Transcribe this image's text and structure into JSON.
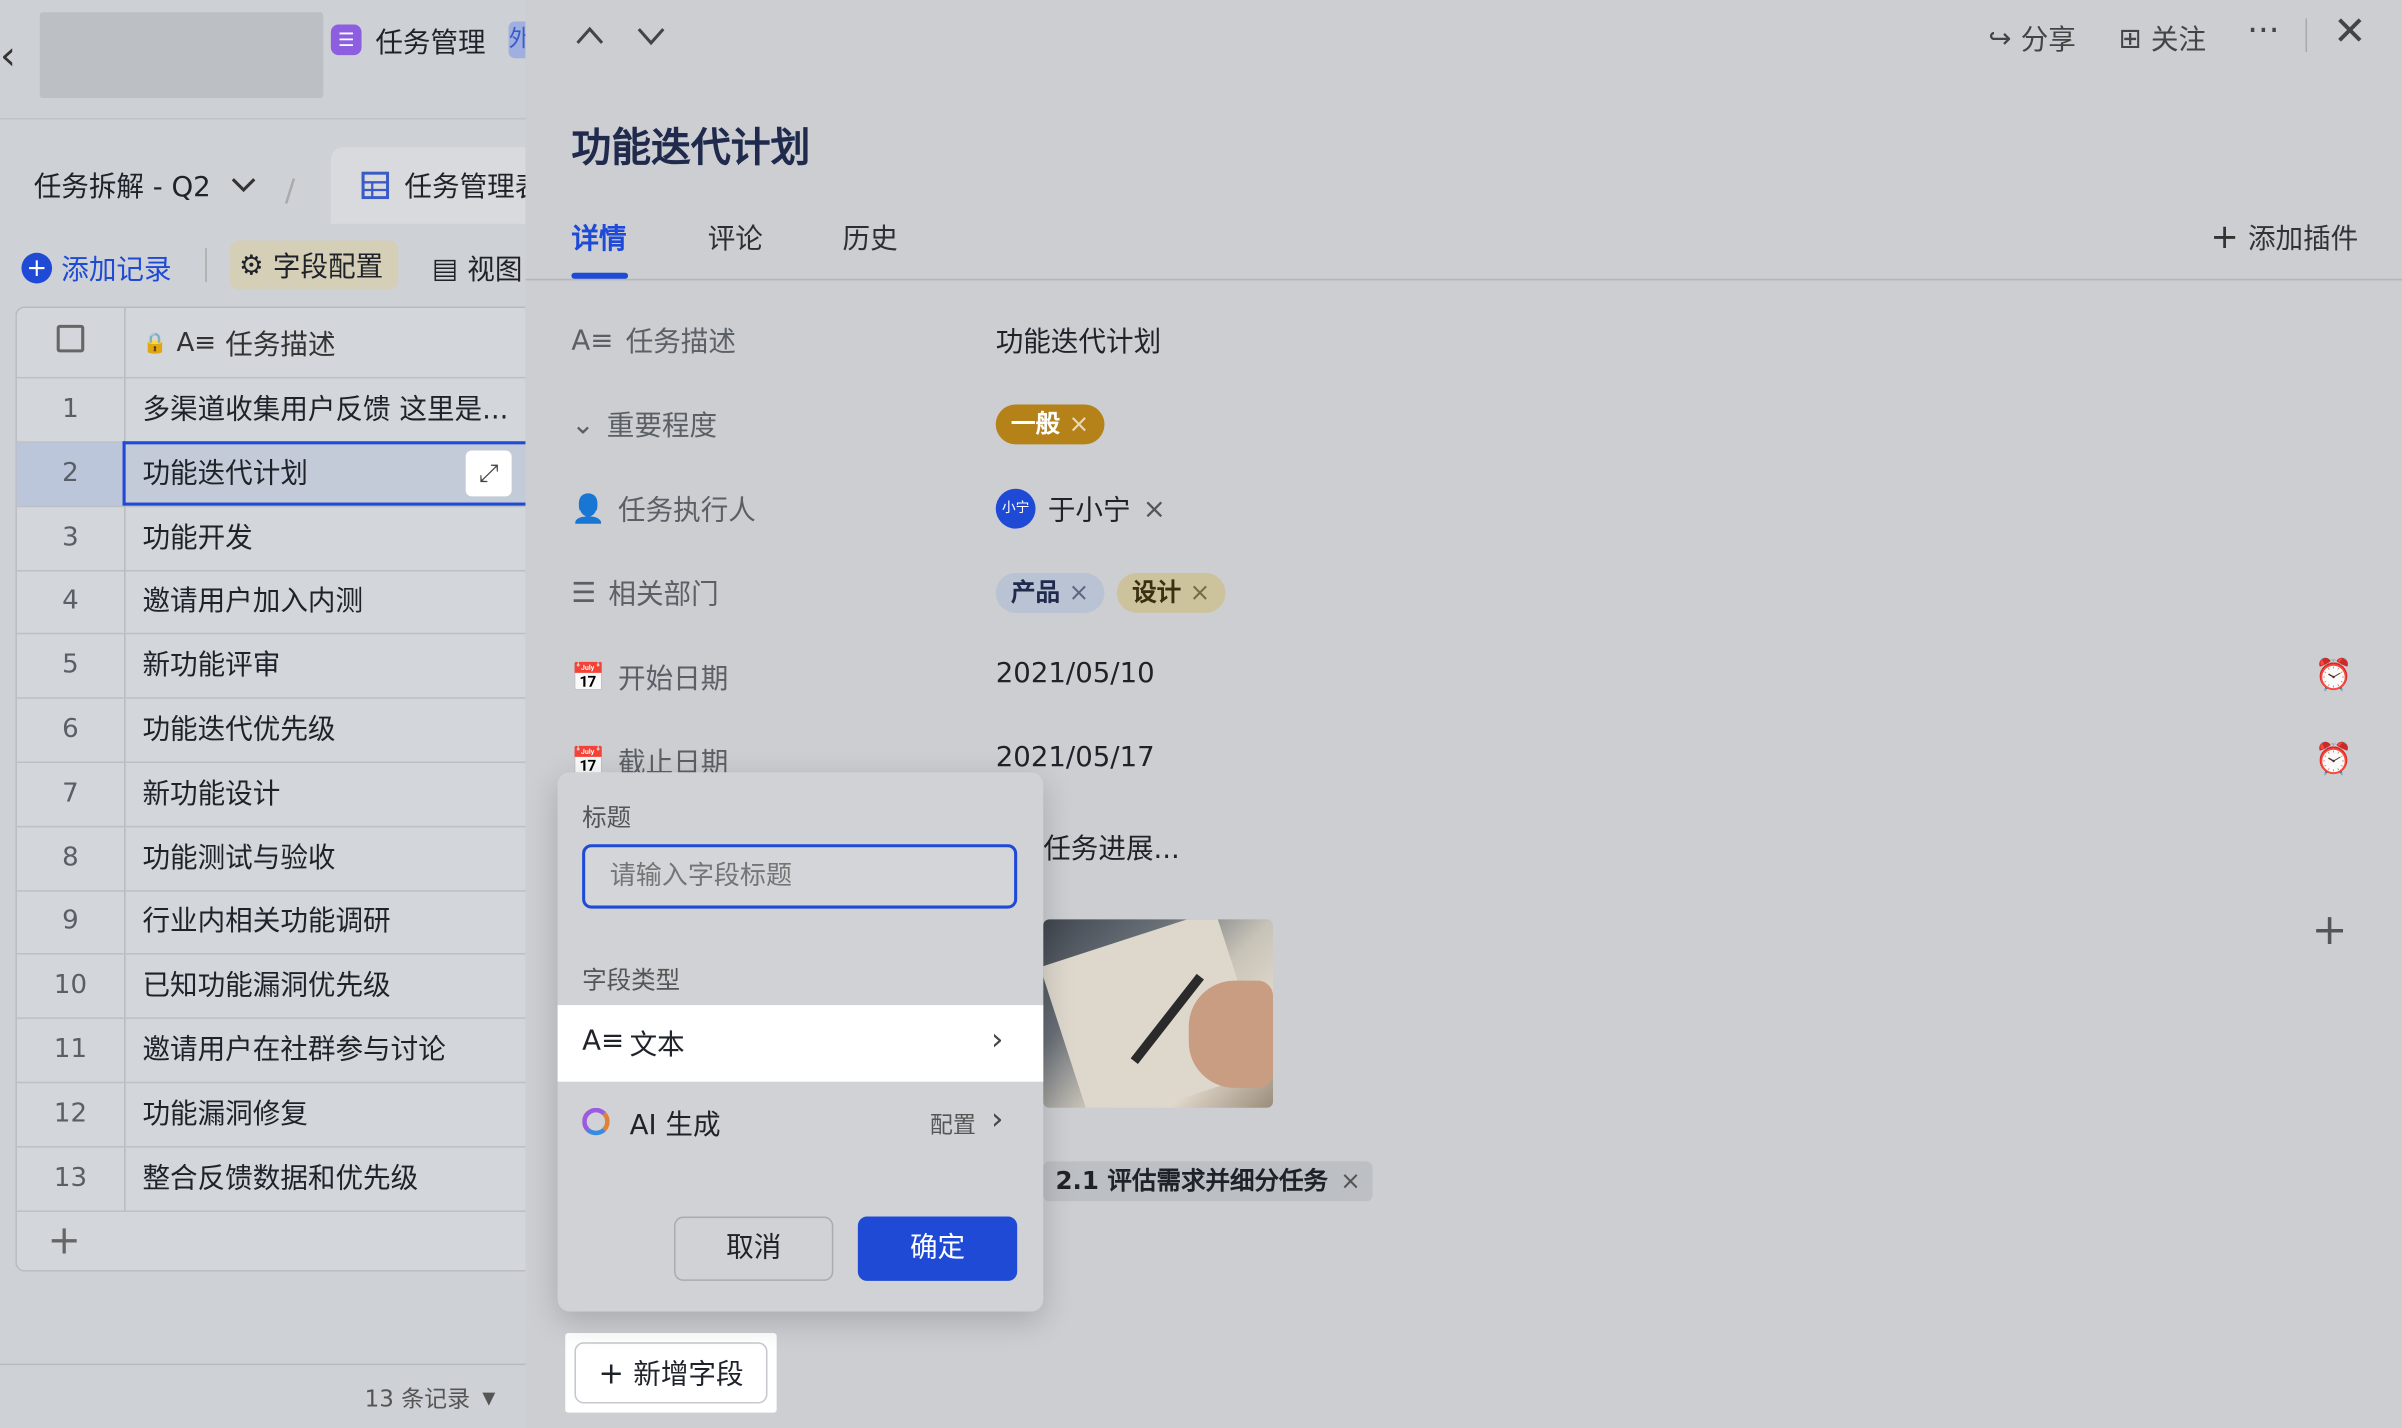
{
  "left": {
    "app_tab": "任务管理",
    "app_tab_badge": "外",
    "view_name": "任务拆解 - Q2",
    "table_tab": "任务管理表",
    "add_record": "添加记录",
    "field_config": "字段配置",
    "view_label": "视图",
    "column_header": "任务描述",
    "rows": [
      {
        "n": "1",
        "t": "多渠道收集用户反馈 这里是..."
      },
      {
        "n": "2",
        "t": "功能迭代计划"
      },
      {
        "n": "3",
        "t": "功能开发"
      },
      {
        "n": "4",
        "t": "邀请用户加入内测"
      },
      {
        "n": "5",
        "t": "新功能评审"
      },
      {
        "n": "6",
        "t": "功能迭代优先级"
      },
      {
        "n": "7",
        "t": "新功能设计"
      },
      {
        "n": "8",
        "t": "功能测试与验收"
      },
      {
        "n": "9",
        "t": "行业内相关功能调研"
      },
      {
        "n": "10",
        "t": "已知功能漏洞优先级"
      },
      {
        "n": "11",
        "t": "邀请用户在社群参与讨论"
      },
      {
        "n": "12",
        "t": "功能漏洞修复"
      },
      {
        "n": "13",
        "t": "整合反馈数据和优先级"
      }
    ],
    "record_count": "13 条记录"
  },
  "panel": {
    "share": "分享",
    "follow": "关注",
    "title": "功能迭代计划",
    "tabs": [
      "详情",
      "评论",
      "历史"
    ],
    "add_plugin": "添加插件",
    "fields": {
      "desc_label": "任务描述",
      "desc_value": "功能迭代计划",
      "priority_label": "重要程度",
      "priority_value": "一般",
      "assignee_label": "任务执行人",
      "assignee_avatar": "小宁",
      "assignee_value": "于小宁",
      "dept_label": "相关部门",
      "dept_1": "产品",
      "dept_2": "设计",
      "start_label": "开始日期",
      "start_value": "2021/05/10",
      "end_label": "截止日期",
      "end_value": "2021/05/17",
      "progress_partial": "任务进展...",
      "parent_partial": "2.1 评估需求并细分任务"
    },
    "new_field": "新增字段"
  },
  "popup": {
    "title_label": "标题",
    "title_placeholder": "请输入字段标题",
    "type_label": "字段类型",
    "type_text": "文本",
    "type_ai": "AI 生成",
    "ai_config": "配置",
    "cancel": "取消",
    "confirm": "确定"
  },
  "colors": {
    "accent": "#1f4ad6",
    "priority": "#b48218",
    "dept_1": "#b9c3d3",
    "dept_2": "#ccc39d"
  }
}
